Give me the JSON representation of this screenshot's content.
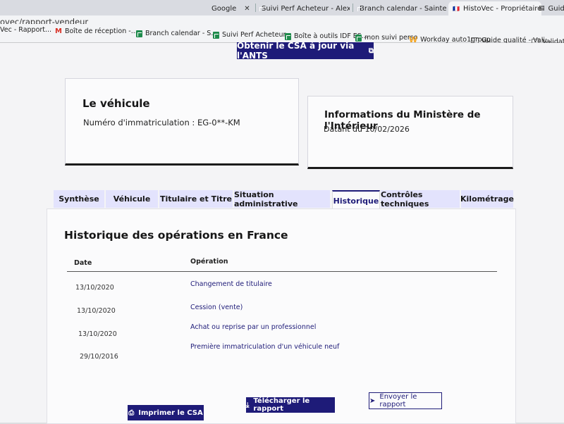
{
  "browser": {
    "tabs": [
      {
        "label": "Google",
        "close": "✕"
      },
      {
        "label": "Suivi Perf Acheteur - Alexis",
        "close": "✕"
      },
      {
        "label": "Branch calendar - Sainte-G",
        "close": "✕"
      },
      {
        "label": "HistoVec - Propriétaire",
        "close": "✕"
      },
      {
        "label": "Guide q"
      }
    ],
    "url": "ovec/rapport-vendeur",
    "bookmarks": [
      "Vec - Rapport...",
      "Boîte de réception -...",
      "Branch calendar - S...",
      "Suivi Perf Acheteur...",
      "Boîte à outils IDF ES...",
      "mon suivi perso",
      "Workday auto1group",
      "Guide qualité - Vali...",
      "Validations"
    ]
  },
  "cta": {
    "label": "Obtenir le CSA à jour via l'ANTS",
    "icon": "external-link-icon"
  },
  "vehicle_card": {
    "title": "Le véhicule",
    "plate": "Numéro d'immatriculation : EG-0**-KM"
  },
  "ministry_card": {
    "title": "Informations du Ministère de l'Intérieur",
    "date": "Datant du 10/02/2026"
  },
  "tabs": [
    {
      "label": "Synthèse"
    },
    {
      "label": "Véhicule"
    },
    {
      "label": "Titulaire et Titre"
    },
    {
      "label": "Situation administrative"
    },
    {
      "label": "Historique"
    },
    {
      "label": "Contrôles techniques"
    },
    {
      "label": "Kilométrage"
    }
  ],
  "active_tab": "Historique",
  "history": {
    "title": "Historique des opérations en France",
    "columns": [
      "Date",
      "Opération"
    ],
    "rows": [
      {
        "date": "13/10/2020",
        "operation": "Changement de titulaire"
      },
      {
        "date": "13/10/2020",
        "operation": "Cession (vente)"
      },
      {
        "date": "13/10/2020",
        "operation": "Achat ou reprise par un professionnel"
      },
      {
        "date": "29/10/2016",
        "operation": "Première immatriculation d'un véhicule neuf"
      }
    ]
  },
  "actions": {
    "print": "Imprimer le CSA",
    "download": "Télécharger le rapport",
    "send": "Envoyer le rapport"
  },
  "colors": {
    "accent": "#1e1b78",
    "tab_bg": "#e3e3fd",
    "page_bg": "#f4f4f6"
  }
}
